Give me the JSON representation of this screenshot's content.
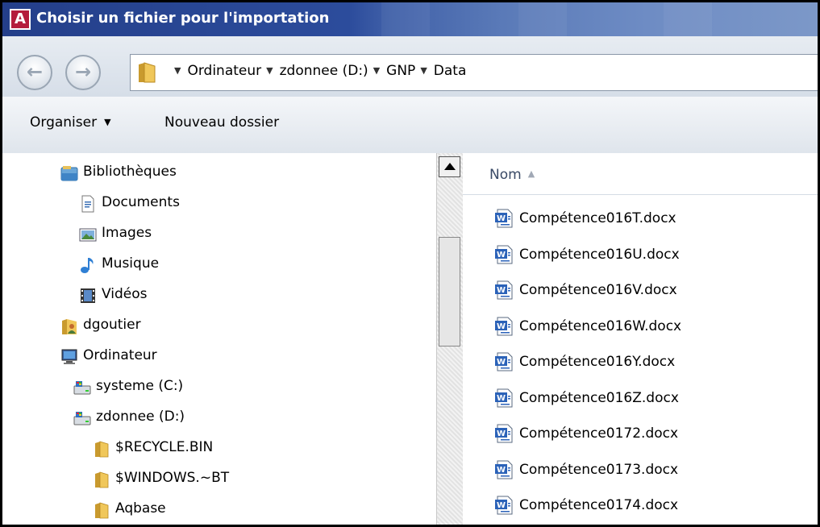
{
  "window": {
    "title": "Choisir un fichier pour l'importation",
    "app_icon_letter": "A",
    "accent": "#b41c3c",
    "titlebar_color": "#2c4c9c"
  },
  "nav": {
    "back_glyph": "←",
    "forward_glyph": "→"
  },
  "address": {
    "separator": "▼",
    "segments": [
      "Ordinateur",
      "zdonnee (D:)",
      "GNP",
      "Data"
    ]
  },
  "toolbar": {
    "organize_label": "Organiser",
    "organize_caret": "▼",
    "new_folder_label": "Nouveau dossier"
  },
  "tree": [
    {
      "label": "Bibliothèques",
      "icon": "libraries-icon"
    },
    {
      "label": "Documents",
      "icon": "documents-icon"
    },
    {
      "label": "Images",
      "icon": "images-icon"
    },
    {
      "label": "Musique",
      "icon": "music-icon"
    },
    {
      "label": "Vidéos",
      "icon": "videos-icon"
    },
    {
      "label": "dgoutier",
      "icon": "user-folder-icon"
    },
    {
      "label": "Ordinateur",
      "icon": "computer-icon"
    },
    {
      "label": "systeme (C:)",
      "icon": "drive-icon"
    },
    {
      "label": "zdonnee (D:)",
      "icon": "drive-icon"
    },
    {
      "label": "$RECYCLE.BIN",
      "icon": "folder-icon"
    },
    {
      "label": "$WINDOWS.~BT",
      "icon": "folder-icon"
    },
    {
      "label": "Aqbase",
      "icon": "folder-icon"
    }
  ],
  "file_list": {
    "column_name": "Nom",
    "sort_glyph": "▲",
    "files": [
      "Compétence016T.docx",
      "Compétence016U.docx",
      "Compétence016V.docx",
      "Compétence016W.docx",
      "Compétence016Y.docx",
      "Compétence016Z.docx",
      "Compétence0172.docx",
      "Compétence0173.docx",
      "Compétence0174.docx"
    ]
  }
}
